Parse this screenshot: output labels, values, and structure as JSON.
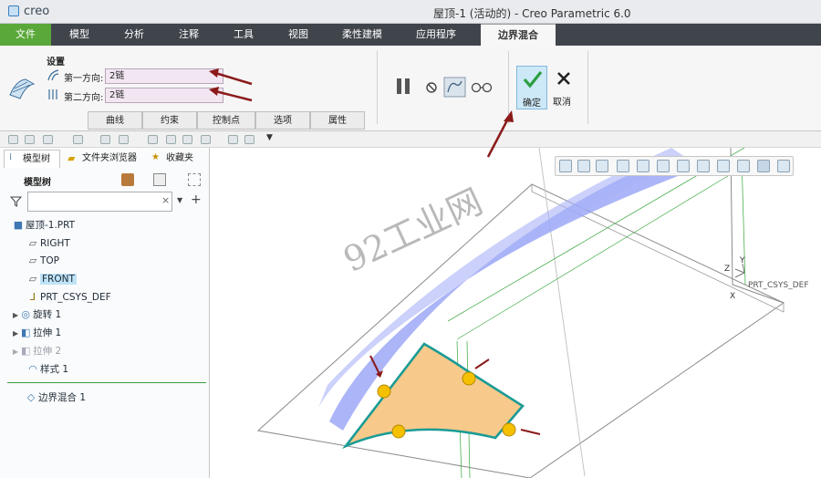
{
  "titlebar": {
    "logo": "creo",
    "title": "屋顶-1 (活动的) - Creo Parametric 6.0"
  },
  "menu": [
    "文件",
    "模型",
    "分析",
    "注释",
    "工具",
    "视图",
    "柔性建模",
    "应用程序",
    "边界混合"
  ],
  "ribbon": {
    "settings_label": "设置",
    "first_dir_label": "第一方向:",
    "first_dir_value": "2链",
    "second_dir_label": "第二方向:",
    "second_dir_value": "2链",
    "tabs": [
      "曲线",
      "约束",
      "控制点",
      "选项",
      "属性"
    ],
    "ok_label": "确定",
    "cancel_label": "取消"
  },
  "panel": {
    "tabs": [
      "模型树",
      "文件夹浏览器",
      "收藏夹"
    ],
    "tree_header": "模型树",
    "filter_placeholder": "",
    "items": [
      "屋顶-1.PRT",
      "RIGHT",
      "TOP",
      "FRONT",
      "PRT_CSYS_DEF",
      "旋转 1",
      "拉伸 1",
      "拉伸 2",
      "样式 1",
      "边界混合 1"
    ]
  },
  "viewport": {
    "watermark": "92工业网",
    "csys_label": "PRT_CSYS_DEF",
    "axis_z": "Z",
    "axis_y": "Y",
    "axis_x": "X"
  },
  "colors": {
    "accent_green": "#5aa83a",
    "menubar": "#40454c",
    "surface_blue": "#8f9cf4",
    "surface_orange": "#f7c98a",
    "curve_teal": "#1a9b95",
    "arrow_red": "#8b1a1a"
  }
}
